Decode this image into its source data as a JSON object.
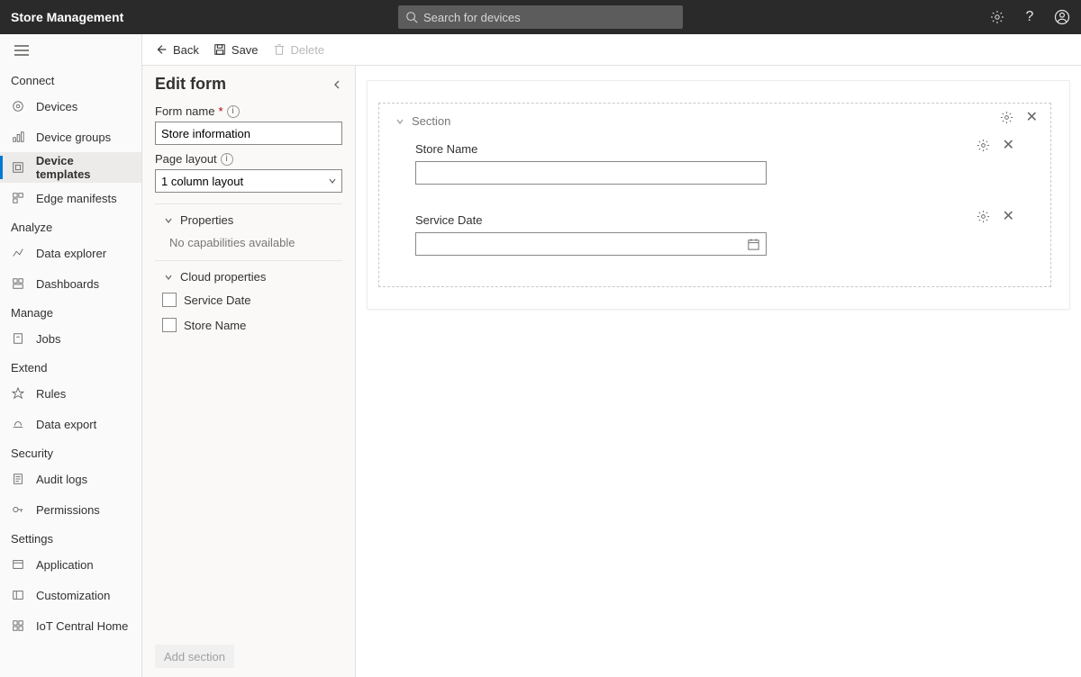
{
  "app": {
    "title": "Store Management"
  },
  "search": {
    "placeholder": "Search for devices"
  },
  "toolbar": {
    "back": "Back",
    "save": "Save",
    "delete": "Delete"
  },
  "sidebar": {
    "groups": [
      {
        "label": "Connect",
        "items": [
          {
            "label": "Devices"
          },
          {
            "label": "Device groups"
          },
          {
            "label": "Device templates"
          },
          {
            "label": "Edge manifests"
          }
        ]
      },
      {
        "label": "Analyze",
        "items": [
          {
            "label": "Data explorer"
          },
          {
            "label": "Dashboards"
          }
        ]
      },
      {
        "label": "Manage",
        "items": [
          {
            "label": "Jobs"
          }
        ]
      },
      {
        "label": "Extend",
        "items": [
          {
            "label": "Rules"
          },
          {
            "label": "Data export"
          }
        ]
      },
      {
        "label": "Security",
        "items": [
          {
            "label": "Audit logs"
          },
          {
            "label": "Permissions"
          }
        ]
      },
      {
        "label": "Settings",
        "items": [
          {
            "label": "Application"
          },
          {
            "label": "Customization"
          },
          {
            "label": "IoT Central Home"
          }
        ]
      }
    ]
  },
  "editor": {
    "title": "Edit form",
    "formNameLabel": "Form name",
    "formNameValue": "Store information",
    "pageLayoutLabel": "Page layout",
    "pageLayoutValue": "1 column layout",
    "propertiesLabel": "Properties",
    "noCaps": "No capabilities available",
    "cloudPropsLabel": "Cloud properties",
    "cloud": [
      {
        "label": "Service Date"
      },
      {
        "label": "Store Name"
      }
    ],
    "addSection": "Add section"
  },
  "canvas": {
    "sectionLabel": "Section",
    "fields": [
      {
        "label": "Store Name",
        "type": "text"
      },
      {
        "label": "Service Date",
        "type": "date"
      }
    ]
  }
}
